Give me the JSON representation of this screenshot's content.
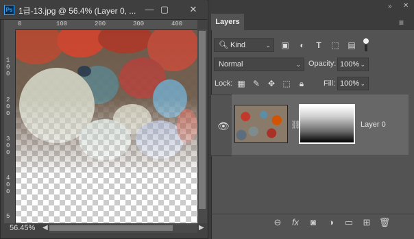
{
  "document": {
    "title": "1급-13.jpg @ 56.4% (Layer 0, ...",
    "app_icon": "Ps",
    "window_buttons": {
      "minimize": "—",
      "restore": "▢",
      "close": "✕"
    },
    "ruler_top_ticks": [
      "0",
      "100",
      "200",
      "300",
      "400"
    ],
    "ruler_left_ticks": [
      "1\n0\n0",
      "2\n0\n0",
      "3\n0\n0",
      "4\n0\n0",
      "5"
    ],
    "zoom": "56.45%"
  },
  "layers_panel": {
    "tab_label": "Layers",
    "collapse_icon": "»",
    "filter_kind": "Kind",
    "blend_mode": "Normal",
    "opacity_label": "Opacity:",
    "opacity_value": "100%",
    "lock_label": "Lock:",
    "fill_label": "Fill:",
    "fill_value": "100%",
    "layer": {
      "name": "Layer 0",
      "visible": true
    }
  },
  "colors": {
    "accent": "#31a8ff",
    "panel_bg": "#535353",
    "doc_bg": "#424242"
  }
}
